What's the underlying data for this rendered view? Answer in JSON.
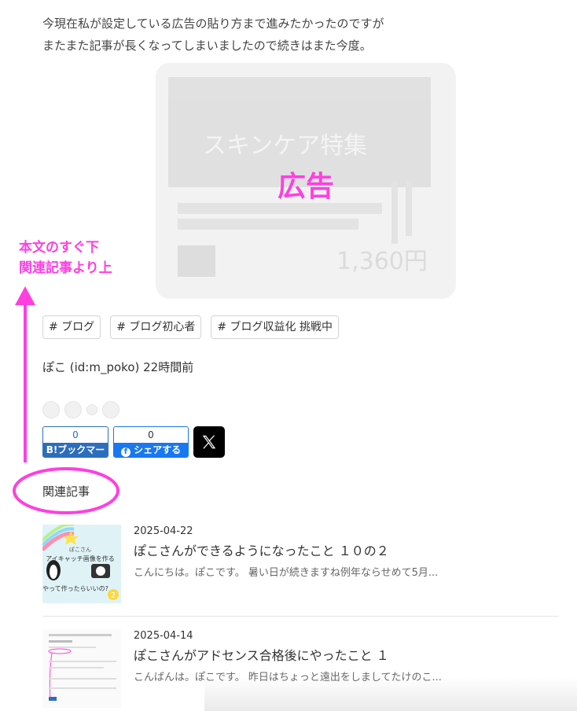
{
  "article": {
    "intro_line1": "今現在私が設定している広告の貼り方まで進みたかったのですが",
    "intro_line2": "またまた記事が長くなってしまいましたので続きはまた今度。"
  },
  "ad": {
    "label": "広告",
    "ghost_line1": "スキンケア特集",
    "ghost_price": "1,360円"
  },
  "annotation": {
    "line1": "本文のすぐ下",
    "line2": "関連記事より上",
    "color": "#ff3fe0"
  },
  "tags": [
    "# ブログ",
    "# ブログ初心者",
    "# ブログ収益化 挑戦中"
  ],
  "author_line": "ぽこ (id:m_poko) 22時間前",
  "share": {
    "hatena_count": "0",
    "hatena_label": "B!ブックマーク",
    "facebook_count": "0",
    "facebook_label": "シェアする",
    "x_label": "𝕏"
  },
  "related": {
    "heading": "関連記事",
    "entries": [
      {
        "date": "2025-04-22",
        "title": "ぽこさんができるようになったこと １０の２",
        "excerpt": "こんにちは。ぽこです。 暑い日が続きますね例年ならせめて5月...",
        "thumb_caption1": "ぽこさん",
        "thumb_caption2": "アイキャッチ画像を作る",
        "thumb_caption3": "やって作ったらいいの?",
        "thumb_badge": "2"
      },
      {
        "date": "2025-04-14",
        "title": "ぽこさんがアドセンス合格後にやったこと １",
        "excerpt": "こんばんは。ぽこです。 昨日はちょっと遠出をしましてたけのこ..."
      }
    ]
  }
}
